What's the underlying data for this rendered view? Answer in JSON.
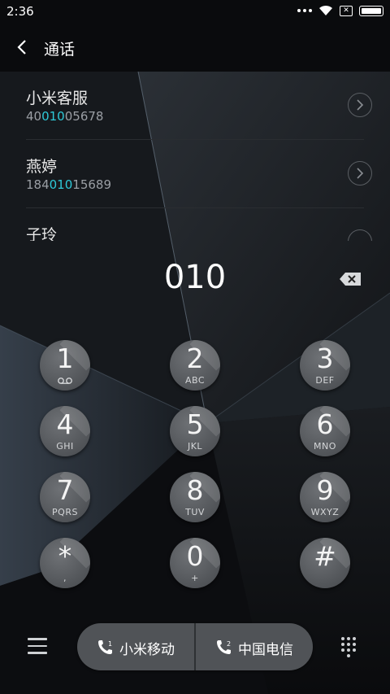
{
  "status_bar": {
    "time": "2:36",
    "icons": [
      "dots-icon",
      "wifi-icon",
      "no-sim-icon",
      "battery-icon"
    ]
  },
  "header": {
    "title": "通话",
    "back_icon": "back-arrow-icon"
  },
  "contacts": [
    {
      "name": "小米客服",
      "number_pre": "40",
      "number_match": "010",
      "number_post": "05678"
    },
    {
      "name": "燕婷",
      "number_pre": "184",
      "number_match": "010",
      "number_post": "15689"
    },
    {
      "name": "子玲",
      "number_pre": "",
      "number_match": "",
      "number_post": ""
    }
  ],
  "dialer": {
    "input": "010",
    "delete_icon": "backspace-icon",
    "keys": [
      {
        "digit": "1",
        "letters": ""
      },
      {
        "digit": "2",
        "letters": "ABC"
      },
      {
        "digit": "3",
        "letters": "DEF"
      },
      {
        "digit": "4",
        "letters": "GHI"
      },
      {
        "digit": "5",
        "letters": "JKL"
      },
      {
        "digit": "6",
        "letters": "MNO"
      },
      {
        "digit": "7",
        "letters": "PQRS"
      },
      {
        "digit": "8",
        "letters": "TUV"
      },
      {
        "digit": "9",
        "letters": "WXYZ"
      },
      {
        "digit": "*",
        "letters": ","
      },
      {
        "digit": "0",
        "letters": "+"
      },
      {
        "digit": "#",
        "letters": ""
      }
    ]
  },
  "bottom_bar": {
    "sim1_label": "小米移动",
    "sim1_index": "1",
    "sim2_label": "中国电信",
    "sim2_index": "2",
    "menu_icon": "menu-icon",
    "keypad_icon": "keypad-toggle-icon"
  },
  "colors": {
    "accent": "#2ec9d8",
    "background": "#0e1013",
    "key": "#5a5d61"
  }
}
